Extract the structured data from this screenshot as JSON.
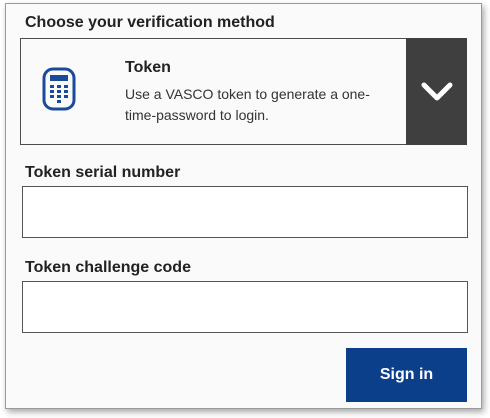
{
  "heading": "Choose your verification method",
  "method": {
    "title": "Token",
    "description": "Use a VASCO token to generate a one-time-password to login.",
    "icon": "token-calculator-icon",
    "dropdown_icon": "chevron-down-icon"
  },
  "fields": {
    "serial_label": "Token serial number",
    "serial_value": "",
    "challenge_label": "Token challenge code",
    "challenge_value": ""
  },
  "signin_label": "Sign in",
  "colors": {
    "accent": "#0c3f8a",
    "dropdown_bg": "#3f3f3f",
    "icon": "#1a4a9a"
  }
}
